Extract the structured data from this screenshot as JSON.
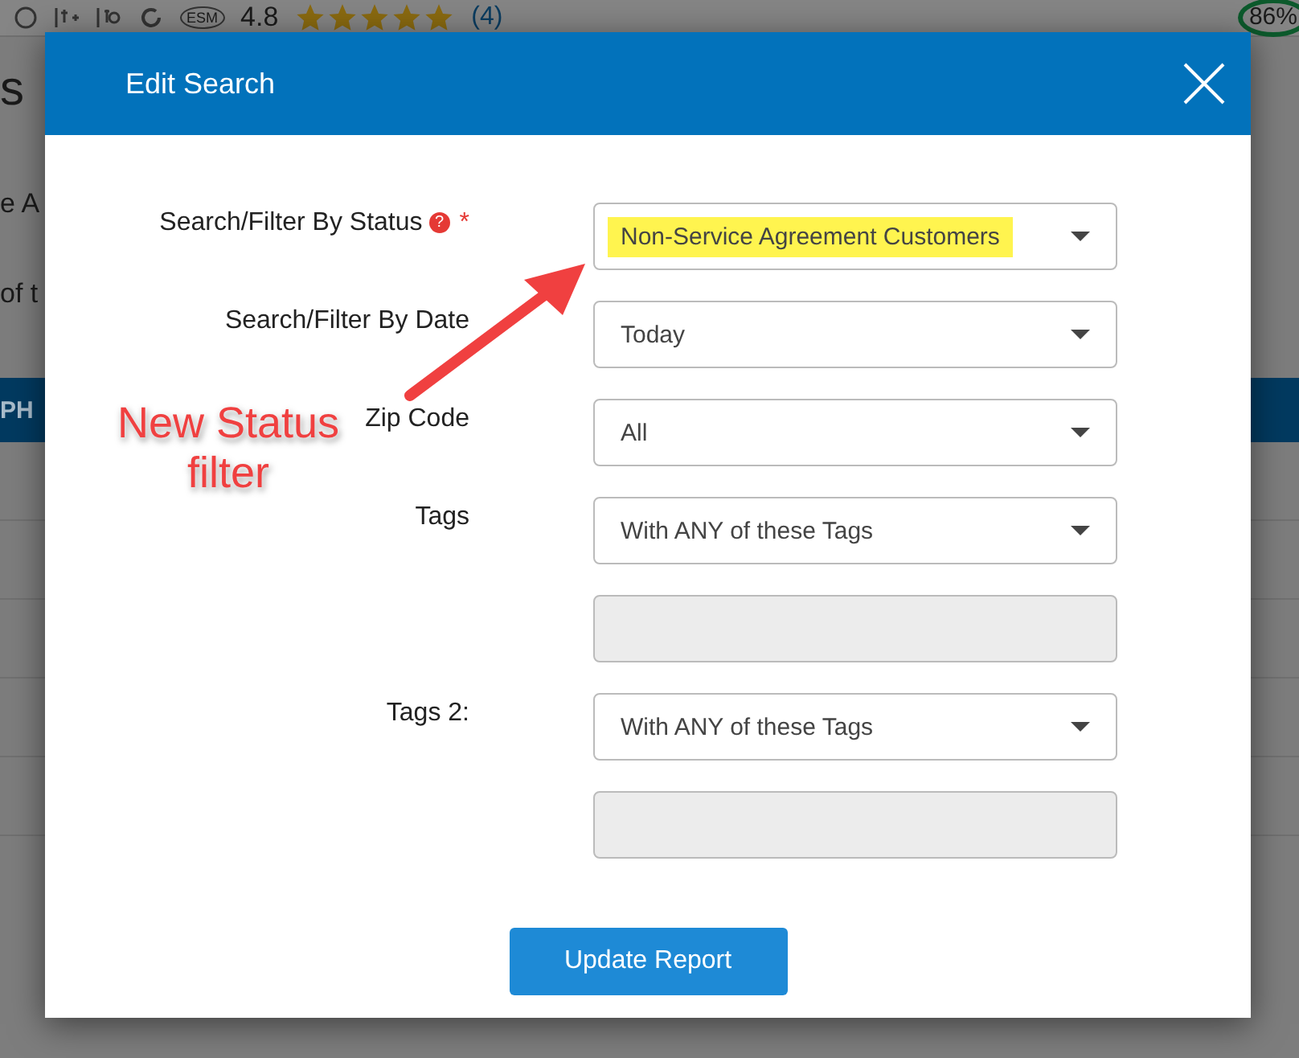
{
  "background": {
    "toolbar_badge": "ESM",
    "rating": "4.8",
    "stars": 5,
    "review_count": "(4)",
    "score": "86%",
    "heading_fragment": "s",
    "text_fragments": [
      "e A",
      "of t"
    ],
    "table_header_fragment": "PH"
  },
  "dialog": {
    "title": "Edit Search",
    "fields": [
      {
        "kind": "select",
        "label": "Search/Filter By Status",
        "help_icon": "?",
        "required_mark": "*",
        "value": "Non-Service Agreement Customers",
        "highlighted": true
      },
      {
        "kind": "select",
        "label": "Search/Filter By Date",
        "value": "Today",
        "highlighted": false
      },
      {
        "kind": "select",
        "label": "Zip Code",
        "value": "All",
        "highlighted": false
      },
      {
        "kind": "select",
        "label": "Tags",
        "value": "With ANY of these Tags",
        "highlighted": false
      },
      {
        "kind": "text",
        "disabled": true
      },
      {
        "kind": "select",
        "label": "Tags 2:",
        "value": "With ANY of these Tags",
        "highlighted": false
      },
      {
        "kind": "text",
        "disabled": true
      }
    ],
    "button": "Update Report"
  },
  "annotation": {
    "text": "New Status filter"
  }
}
